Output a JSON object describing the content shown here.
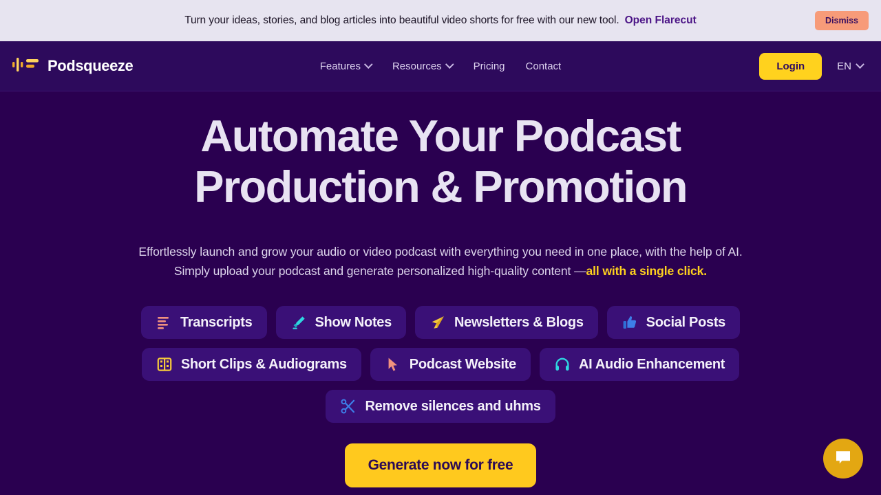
{
  "banner": {
    "message": "Turn your ideas, stories, and blog articles into beautiful video shorts for free with our new tool.",
    "link_label": "Open Flarecut",
    "dismiss_label": "Dismiss",
    "background_color": "#E7E4F0",
    "link_color": "#4B1486",
    "dismiss_color": "#F79B79"
  },
  "navbar": {
    "brand": "Podsqueeze",
    "logo_icon": "audio-waveform-icon",
    "links": [
      {
        "label": "Features",
        "has_dropdown": true
      },
      {
        "label": "Resources",
        "has_dropdown": true
      },
      {
        "label": "Pricing",
        "has_dropdown": false
      },
      {
        "label": "Contact",
        "has_dropdown": false
      }
    ],
    "login_label": "Login",
    "language": "EN",
    "accent_color": "#FFD21E",
    "background_color": "#2D0A5C"
  },
  "hero": {
    "headline_line1": "Automate Your Podcast",
    "headline_line2": "Production & Promotion",
    "subhead_line1": "Effortlessly launch and grow your audio or video podcast with everything you need in one place, with the help of AI.",
    "subhead_line2_prefix": "Simply upload your podcast and generate personalized high-quality content —",
    "subhead_highlight": "all with a single click.",
    "highlight_color": "#FFD21E",
    "background_color": "#2A0050"
  },
  "chips": {
    "row1": [
      {
        "label": "Transcripts",
        "icon": "transcript-lines-icon",
        "icon_color": "#F2927E"
      },
      {
        "label": "Show Notes",
        "icon": "highlighter-pen-icon",
        "icon_color": "#2FD6E0"
      },
      {
        "label": "Newsletters & Blogs",
        "icon": "paper-plane-icon",
        "icon_color": "#F5C93B"
      },
      {
        "label": "Social Posts",
        "icon": "thumbs-up-icon",
        "icon_color": "#3D7FE8"
      }
    ],
    "row2": [
      {
        "label": "Short Clips & Audiograms",
        "icon": "film-strip-icon",
        "icon_color": "#F5C93B"
      },
      {
        "label": "Podcast Website",
        "icon": "cursor-arrow-icon",
        "icon_color": "#F2927E"
      },
      {
        "label": "AI Audio Enhancement",
        "icon": "headphones-icon",
        "icon_color": "#2FD6E0"
      }
    ],
    "row3": [
      {
        "label": "Remove silences and uhms",
        "icon": "scissors-icon",
        "icon_color": "#3D7FE8"
      }
    ],
    "background_color": "#3A1077"
  },
  "cta": {
    "label": "Generate now for free",
    "background_color": "#FFC91E"
  },
  "chat": {
    "icon": "chat-bubble-icon",
    "background_color": "#E3A712"
  }
}
